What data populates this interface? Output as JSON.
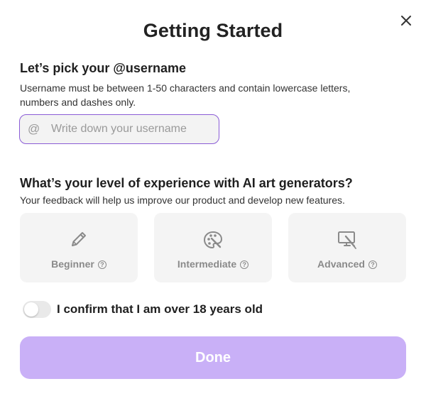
{
  "modal": {
    "title": "Getting Started",
    "close_icon": "close-icon"
  },
  "username": {
    "heading": "Let’s pick your @username",
    "description": "Username must be between 1-50 characters and contain lowercase letters, numbers and dashes only.",
    "at_symbol": "@",
    "placeholder": "Write down your username",
    "value": ""
  },
  "experience": {
    "heading": "What’s your level of experience with AI art generators?",
    "description": "Your feedback will help us improve our product and develop new features.",
    "options": [
      {
        "label": "Beginner",
        "icon": "pencil-icon"
      },
      {
        "label": "Intermediate",
        "icon": "palette-icon"
      },
      {
        "label": "Advanced",
        "icon": "drawing-tablet-icon"
      }
    ],
    "help_glyph": "?"
  },
  "age_confirm": {
    "label": "I confirm that I am over 18 years old",
    "checked": false
  },
  "done_button": {
    "label": "Done",
    "color": "#c9b0f7"
  },
  "colors": {
    "accent": "#8b5cd6",
    "card_bg": "#f4f4f4"
  }
}
